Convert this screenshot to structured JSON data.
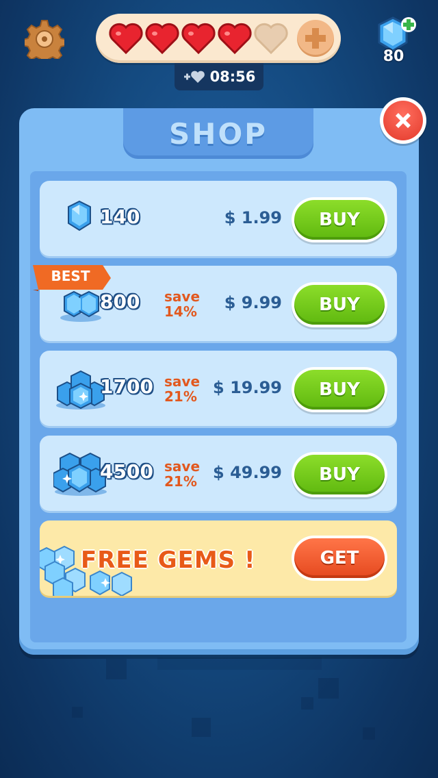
{
  "header": {
    "hearts_full": 4,
    "hearts_total": 5,
    "timer": "08:56",
    "gem_count": "80"
  },
  "shop": {
    "title": "SHOP",
    "best_label": "BEST",
    "items": [
      {
        "amount": "140",
        "save_label": "",
        "save_value": "",
        "price": "$ 1.99",
        "button": "BUY"
      },
      {
        "amount": "800",
        "save_label": "save",
        "save_value": "14%",
        "price": "$ 9.99",
        "button": "BUY"
      },
      {
        "amount": "1700",
        "save_label": "save",
        "save_value": "21%",
        "price": "$ 19.99",
        "button": "BUY"
      },
      {
        "amount": "4500",
        "save_label": "save",
        "save_value": "21%",
        "price": "$ 49.99",
        "button": "BUY"
      }
    ],
    "free": {
      "title": "FREE GEMS !",
      "button": "GET"
    }
  },
  "colors": {
    "heart_full": "#e8242f",
    "heart_empty": "#e8cdb0",
    "buy_green": "#6cc61a",
    "get_orange": "#f05a2c",
    "close_red": "#e83a2c"
  }
}
